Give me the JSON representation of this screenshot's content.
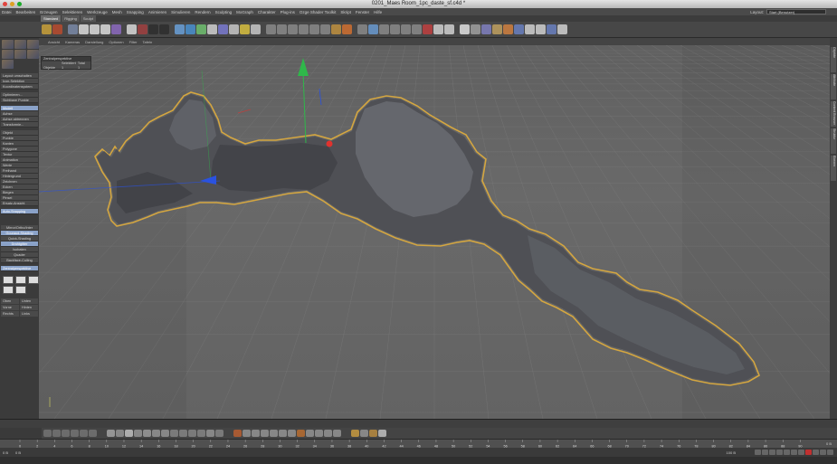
{
  "window": {
    "title": "0201_Maes Room_1pc_daste_sf.c4d *"
  },
  "menu": [
    "Datei",
    "Bearbeiten",
    "Erzeugen",
    "Selektieren",
    "Werkzeuge",
    "Mesh",
    "Snapping",
    "Animieren",
    "Simulieren",
    "Rendern",
    "Sculpting",
    "MoGraph",
    "Charakter",
    "Plug-ins",
    "Ozge Shader Toolkit",
    "Skript",
    "Fenster",
    "Hilfe"
  ],
  "layout": {
    "label": "Layout:",
    "value": "Start (Benutzer)"
  },
  "tabs": [
    {
      "label": "Standard",
      "active": true
    },
    {
      "label": "Rigging",
      "active": false
    },
    {
      "label": "Sculpt",
      "active": false
    }
  ],
  "viewport_menu": [
    "Ansicht",
    "Kameras",
    "Darstellung",
    "Optionen",
    "Filter",
    "Tafeln"
  ],
  "stats": {
    "title": "Zentralperspektive",
    "col1": "Selektiert",
    "col2": "Total",
    "row_label": "Objekte",
    "selected": "1",
    "total": "1"
  },
  "left_panel": {
    "group1": [
      "Layout umschalten",
      "Icon-Selektion",
      "Koordinatensystem"
    ],
    "group2": [
      {
        "label": "Optimieren...",
        "hl": false
      },
      {
        "label": "Sichtbare Punkte",
        "hl": false
      }
    ],
    "group3": [
      {
        "label": "Modell",
        "hl": true
      },
      {
        "label": "Achse",
        "hl": false
      },
      {
        "label": "Achse abtrennen",
        "hl": false
      },
      {
        "label": "Transformie...",
        "hl": false
      }
    ],
    "group4": [
      "Objekt",
      "Punkte",
      "Kanten",
      "Polygone",
      "Textur",
      "Animation",
      "Werte",
      "Freihand",
      "Hintergrund",
      "Zeichnen",
      "Ecken",
      "Biegen",
      "Pinsel",
      "Ersatz-Ansicht"
    ],
    "snap": "Auto-Snapping",
    "display": [
      {
        "label": "Mirror/Ortho/Inter",
        "hl": false
      },
      {
        "label": "Gouraud-Shading",
        "hl": true
      },
      {
        "label": "Quick-Shading",
        "hl": false
      },
      {
        "label": "Drahtgitter",
        "hl": true
      },
      {
        "label": "Isobaten",
        "hl": false
      },
      {
        "label": "Quader",
        "hl": false
      },
      {
        "label": "Backface-Culling",
        "hl": false
      }
    ],
    "perspective": "Zentralperspektive",
    "views": [
      "Oben",
      "Unten",
      "Vorne",
      "Hinten",
      "Rechts",
      "Links"
    ]
  },
  "right_tabs": [
    "Objekte",
    "Attribute",
    "Content Browser",
    "Struktur",
    "Ebenen"
  ],
  "timeline": {
    "ticks": [
      "0",
      "2",
      "4",
      "6",
      "8",
      "10",
      "12",
      "14",
      "16",
      "18",
      "20",
      "22",
      "24",
      "26",
      "28",
      "30",
      "32",
      "34",
      "36",
      "38",
      "40",
      "42",
      "44",
      "46",
      "48",
      "50",
      "52",
      "54",
      "56",
      "58",
      "60",
      "62",
      "64",
      "66",
      "68",
      "70",
      "72",
      "74",
      "76",
      "78",
      "80",
      "82",
      "84",
      "86",
      "88",
      "90"
    ],
    "end_label": "0 B",
    "current": "0 B",
    "start_field": "0 B",
    "end_field": "100 B"
  },
  "colors": {
    "accent": "#8aa2c8",
    "outline": "#d4a640",
    "mesh": "#4f5055",
    "axis_y": "#2fb84a",
    "axis_x": "#e0322e",
    "axis_z": "#2a52e0"
  }
}
